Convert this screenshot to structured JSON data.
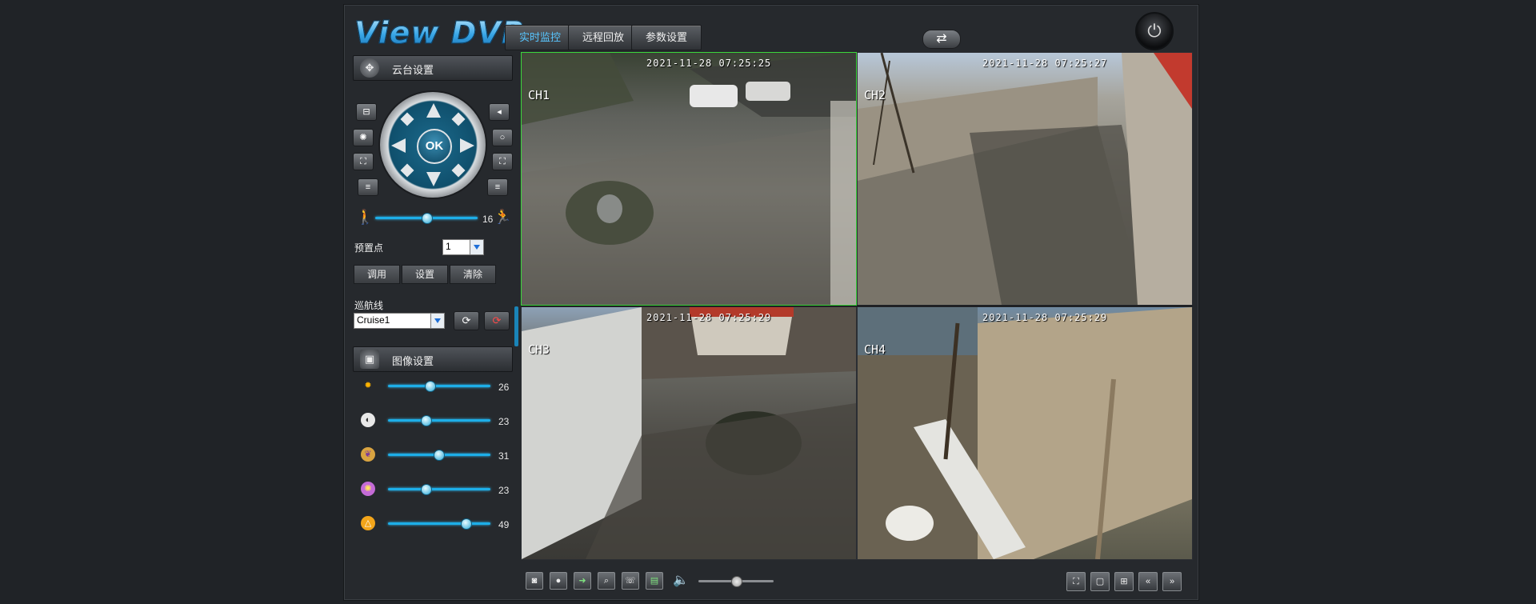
{
  "header": {
    "logo": "View DVR",
    "tabs": [
      {
        "label": "实时监控",
        "active": true
      },
      {
        "label": "远程回放",
        "active": false
      },
      {
        "label": "参数设置",
        "active": false
      }
    ],
    "swap_icon": "swap-arrows-icon",
    "power_icon": "power-icon",
    "swap_glyph": "⇄",
    "power_glyph": "⏻"
  },
  "ptz": {
    "title": "云台设置",
    "ok_label": "OK",
    "speed_value": "16",
    "speed_level": 0.5,
    "preset_label": "预置点",
    "preset_value": "1",
    "buttons": [
      "调用",
      "设置",
      "清除"
    ],
    "cruise_label": "巡航线",
    "cruise_value": "Cruise1"
  },
  "image": {
    "title": "图像设置",
    "sliders": [
      {
        "name": "brightness",
        "icon": "sun-icon",
        "value": "26",
        "level": 0.41
      },
      {
        "name": "contrast",
        "icon": "contrast-icon",
        "value": "23",
        "level": 0.37
      },
      {
        "name": "saturation",
        "icon": "palette-icon",
        "value": "31",
        "level": 0.49
      },
      {
        "name": "hue",
        "icon": "color-wheel-icon",
        "value": "23",
        "level": 0.37
      },
      {
        "name": "sharpness",
        "icon": "sharpness-icon",
        "value": "49",
        "level": 0.76
      }
    ]
  },
  "cameras": [
    {
      "channel": "CH1",
      "timestamp": "2021-11-28 07:25:25",
      "selected": true
    },
    {
      "channel": "CH2",
      "timestamp": "2021-11-28 07:25:27",
      "selected": false
    },
    {
      "channel": "CH3",
      "timestamp": "2021-11-28 07:25:29",
      "selected": false
    },
    {
      "channel": "CH4",
      "timestamp": "2021-11-28 07:25:29",
      "selected": false
    }
  ],
  "toolbar": {
    "left_icons": [
      "snapshot-icon",
      "record-icon",
      "export-icon",
      "zoom-icon",
      "talk-icon",
      "stream-icon"
    ],
    "volume_icon": "speaker-icon",
    "volume_level": 0.5,
    "right_icons": [
      "fullscreen-icon",
      "single-view-icon",
      "quad-view-icon",
      "previous-page-icon",
      "next-page-icon"
    ]
  },
  "colors": {
    "accent": "#1daee8",
    "active_tab_text": "#58c6ff",
    "selected_border": "#3cd63c"
  }
}
